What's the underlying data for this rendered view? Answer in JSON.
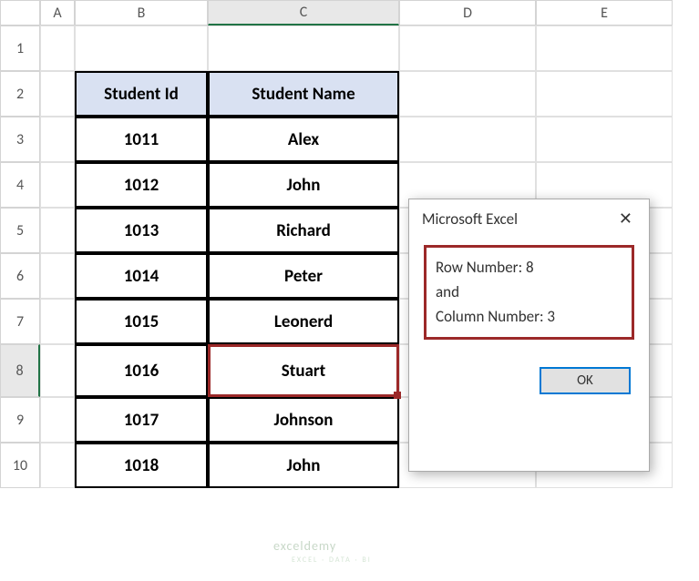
{
  "columns": [
    "A",
    "B",
    "C",
    "D",
    "E"
  ],
  "rows": [
    "1",
    "2",
    "3",
    "4",
    "5",
    "6",
    "7",
    "8",
    "9",
    "10"
  ],
  "active_column": "C",
  "active_row": "8",
  "table": {
    "headers": [
      "Student Id",
      "Student Name"
    ],
    "data": [
      {
        "id": "1011",
        "name": "Alex"
      },
      {
        "id": "1012",
        "name": "John"
      },
      {
        "id": "1013",
        "name": "Richard"
      },
      {
        "id": "1014",
        "name": "Peter"
      },
      {
        "id": "1015",
        "name": "Leonerd"
      },
      {
        "id": "1016",
        "name": "Stuart"
      },
      {
        "id": "1017",
        "name": "Johnson"
      },
      {
        "id": "1018",
        "name": "John"
      }
    ]
  },
  "selected_cell": {
    "col": "C",
    "row": "8",
    "value": "Stuart"
  },
  "dialog": {
    "title": "Microsoft Excel",
    "line1": "Row Number: 8",
    "line2": "and",
    "line3": "Column Number: 3",
    "ok_label": "OK"
  },
  "watermark": "exceldemy",
  "watermark_sub": "EXCEL · DATA · BI"
}
